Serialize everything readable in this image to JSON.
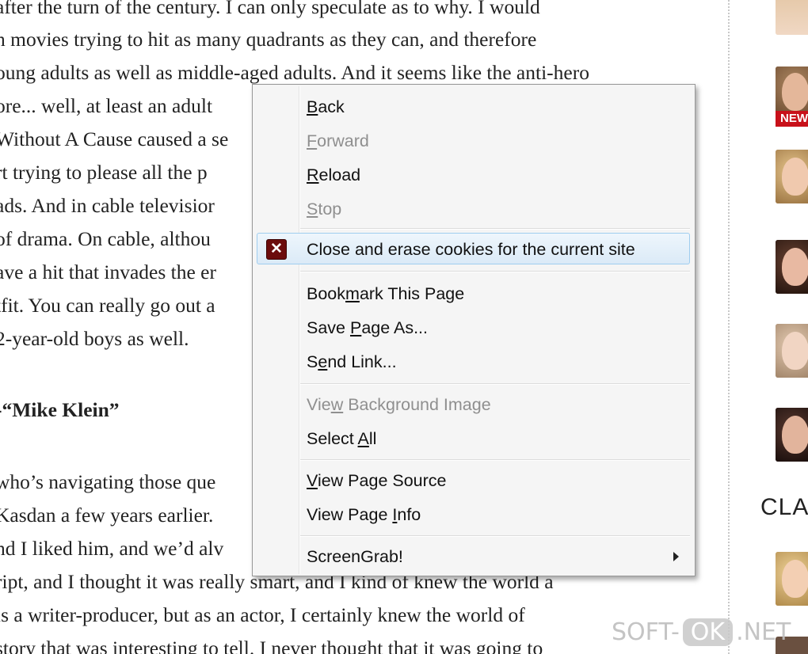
{
  "article": {
    "lines": [
      "after the turn of the century. I can only speculate as to why. I would",
      "n movies trying to hit as many quadrants as they can, and therefore",
      "oung adults as well as middle-aged adults. And it seems like the anti-hero",
      "ore... well, at least an adult",
      "Without A Cause caused a se",
      "rt trying to please all the p",
      "ads. And in cable televisior",
      "of drama. On cable, althou",
      "ave a hit that invades the er",
      "tfit. You can really go out a",
      "2-year-old boys as well.",
      "-“Mike Klein”",
      "who’s navigating those que",
      "Kasdan a few years earlier.",
      "nd I liked him, and we’d alv",
      "ript, and I thought it was really smart, and I kind of knew the world a",
      "is a writer-producer, but as an actor, I certainly knew the world of",
      "story that was interesting to tell. I never thought that it was going to"
    ]
  },
  "sidebar": {
    "new_badge": "NEW",
    "heading": "CLA"
  },
  "menu": {
    "back": {
      "pre": "",
      "key": "B",
      "post": "ack"
    },
    "forward": {
      "pre": "",
      "key": "F",
      "post": "orward"
    },
    "reload": {
      "pre": "",
      "key": "R",
      "post": "eload"
    },
    "stop": {
      "pre": "",
      "key": "S",
      "post": "top"
    },
    "close_erase": {
      "label": "Close and erase cookies for the current site",
      "icon": "close-x-icon"
    },
    "bookmark": {
      "pre": "Book",
      "key": "m",
      "post": "ark This Page"
    },
    "save_page": {
      "pre": "Save ",
      "key": "P",
      "post": "age As..."
    },
    "send_link": {
      "pre": "S",
      "key": "e",
      "post": "nd Link..."
    },
    "view_bg": {
      "pre": "Vie",
      "key": "w",
      "post": " Background Image"
    },
    "select_all": {
      "pre": "Select ",
      "key": "A",
      "post": "ll"
    },
    "view_source": {
      "pre": "",
      "key": "V",
      "post": "iew Page Source"
    },
    "view_info": {
      "pre": "View Page ",
      "key": "I",
      "post": "nfo"
    },
    "screengrab": {
      "label": "ScreenGrab!",
      "icon": "submenu-arrow-icon"
    }
  },
  "watermark": {
    "pre": "SOFT-",
    "ok": "OK",
    "post": ".NET"
  },
  "colors": {
    "menu_bg": "#f5f5f5",
    "hover_border": "#9fcdef",
    "icon_bg": "#6b0c0c",
    "badge_red": "#c8111a"
  }
}
